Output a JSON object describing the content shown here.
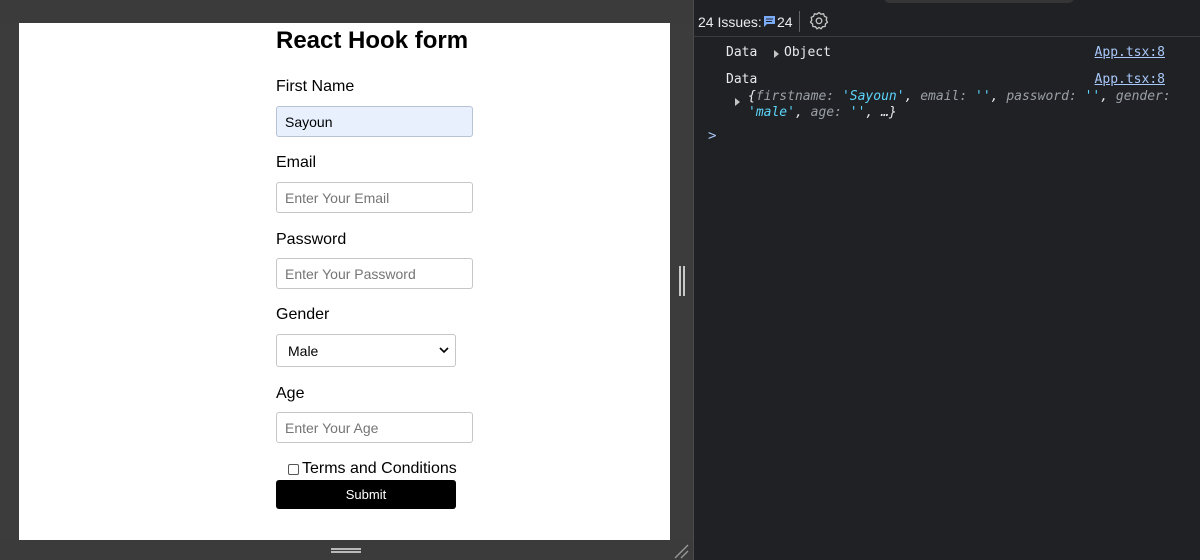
{
  "form": {
    "title": "React Hook form",
    "fields": {
      "first_name": {
        "label": "First Name",
        "value": "Sayoun",
        "placeholder": ""
      },
      "email": {
        "label": "Email",
        "value": "",
        "placeholder": "Enter Your Email"
      },
      "password": {
        "label": "Password",
        "value": "",
        "placeholder": "Enter Your Password"
      },
      "gender": {
        "label": "Gender",
        "selected": "Male"
      },
      "age": {
        "label": "Age",
        "value": "",
        "placeholder": "Enter Your Age"
      }
    },
    "terms_label": "Terms and Conditions",
    "terms_checked": false,
    "submit_label": "Submit"
  },
  "devtools": {
    "issues_label": "24 Issues:",
    "issues_count": "24",
    "console": [
      {
        "label": "Data",
        "preview": "Object",
        "source": "App.tsx:8"
      },
      {
        "label": "Data",
        "source": "App.tsx:8",
        "object": {
          "open": "{",
          "k1": "firstname:",
          "v1": "'Sayoun'",
          "k2": "email:",
          "v2": "''",
          "k3": "password:",
          "v3": "''",
          "k4": "gender:",
          "v4": "'male'",
          "k5": "age:",
          "v5": "''",
          "ellipsis": "…}"
        }
      }
    ],
    "prompt": ">"
  },
  "colors": {
    "autofill_bg": "#e8f0fe",
    "console_bg": "#202124",
    "string_value": "#5cd5fb",
    "link": "#a8c7fa"
  }
}
